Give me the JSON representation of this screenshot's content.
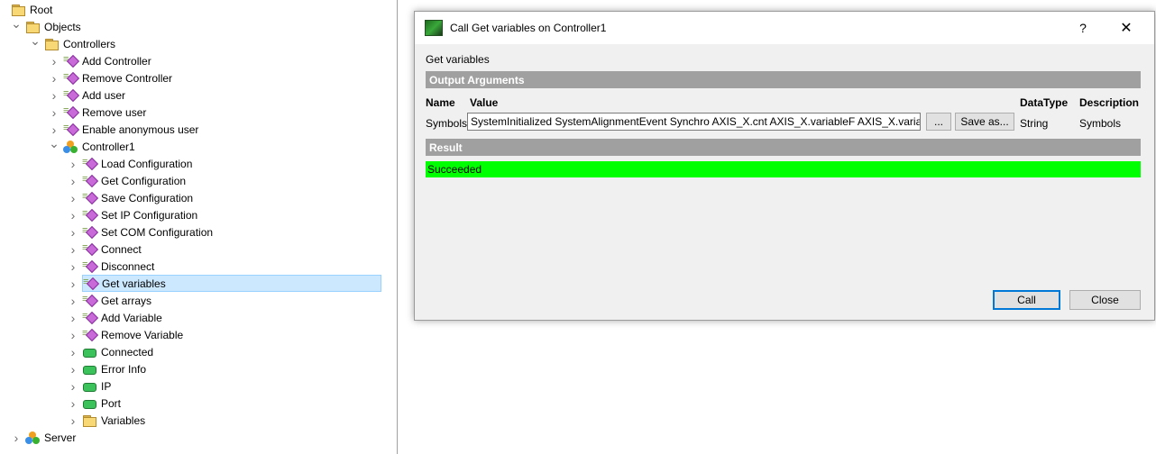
{
  "tree": {
    "items": [
      {
        "label": "Root",
        "icon": "folder-icon",
        "indent": 0,
        "toggle": "none"
      },
      {
        "label": "Objects",
        "icon": "folder-icon",
        "indent": 1,
        "toggle": "expanded"
      },
      {
        "label": "Controllers",
        "icon": "folder-icon",
        "indent": 2,
        "toggle": "expanded"
      },
      {
        "label": "Add Controller",
        "icon": "method-icon",
        "indent": 3,
        "toggle": "collapsed"
      },
      {
        "label": "Remove Controller",
        "icon": "method-icon",
        "indent": 3,
        "toggle": "collapsed"
      },
      {
        "label": "Add user",
        "icon": "method-icon",
        "indent": 3,
        "toggle": "collapsed"
      },
      {
        "label": "Remove user",
        "icon": "method-icon",
        "indent": 3,
        "toggle": "collapsed"
      },
      {
        "label": "Enable anonymous user",
        "icon": "method-icon",
        "indent": 3,
        "toggle": "collapsed"
      },
      {
        "label": "Controller1",
        "icon": "object-icon",
        "indent": 3,
        "toggle": "expanded"
      },
      {
        "label": "Load Configuration",
        "icon": "method-icon",
        "indent": 4,
        "toggle": "collapsed"
      },
      {
        "label": "Get Configuration",
        "icon": "method-icon",
        "indent": 4,
        "toggle": "collapsed"
      },
      {
        "label": "Save Configuration",
        "icon": "method-icon",
        "indent": 4,
        "toggle": "collapsed"
      },
      {
        "label": "Set IP Configuration",
        "icon": "method-icon",
        "indent": 4,
        "toggle": "collapsed"
      },
      {
        "label": "Set COM Configuration",
        "icon": "method-icon",
        "indent": 4,
        "toggle": "collapsed"
      },
      {
        "label": "Connect",
        "icon": "method-icon",
        "indent": 4,
        "toggle": "collapsed"
      },
      {
        "label": "Disconnect",
        "icon": "method-icon",
        "indent": 4,
        "toggle": "collapsed"
      },
      {
        "label": "Get variables",
        "icon": "method-icon",
        "indent": 4,
        "toggle": "collapsed",
        "selected": true
      },
      {
        "label": "Get arrays",
        "icon": "method-icon",
        "indent": 4,
        "toggle": "collapsed"
      },
      {
        "label": "Add Variable",
        "icon": "method-icon",
        "indent": 4,
        "toggle": "collapsed"
      },
      {
        "label": "Remove Variable",
        "icon": "method-icon",
        "indent": 4,
        "toggle": "collapsed"
      },
      {
        "label": "Connected",
        "icon": "variable-icon",
        "indent": 4,
        "toggle": "collapsed"
      },
      {
        "label": "Error Info",
        "icon": "variable-icon",
        "indent": 4,
        "toggle": "collapsed"
      },
      {
        "label": "IP",
        "icon": "variable-icon",
        "indent": 4,
        "toggle": "collapsed"
      },
      {
        "label": "Port",
        "icon": "variable-icon",
        "indent": 4,
        "toggle": "collapsed"
      },
      {
        "label": "Variables",
        "icon": "folder-icon",
        "indent": 4,
        "toggle": "collapsed"
      },
      {
        "label": "Server",
        "icon": "object-icon",
        "indent": 1,
        "toggle": "collapsed"
      }
    ]
  },
  "dialog": {
    "title": "Call Get variables on Controller1",
    "help_label": "?",
    "close_glyph": "✕",
    "subtitle": "Get variables",
    "output_section": "Output Arguments",
    "columns": {
      "name": "Name",
      "value": "Value",
      "datatype": "DataType",
      "description": "Description"
    },
    "argument": {
      "name": "Symbols",
      "value": "SystemInitialized SystemAlignmentEvent Synchro AXIS_X.cnt AXIS_X.variableF AXIS_X.variableB",
      "browse_label": "...",
      "save_label": "Save as...",
      "datatype": "String",
      "description": "Symbols"
    },
    "result_section": "Result",
    "result_text": "Succeeded",
    "call_label": "Call",
    "close_label": "Close"
  },
  "colors": {
    "success": "#00ff00",
    "band": "#a0a0a0",
    "selection": "#cce8ff"
  }
}
